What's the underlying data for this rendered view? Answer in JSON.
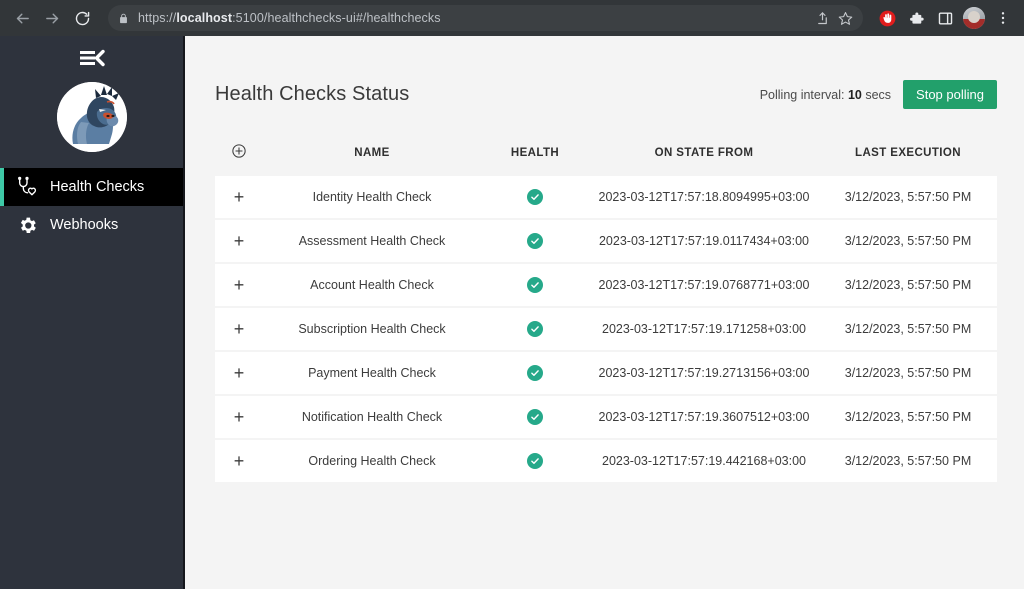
{
  "browser": {
    "url_prefix": "https://",
    "url_host": "localhost",
    "url_rest": ":5100/healthchecks-ui#/healthchecks",
    "back_label": "Back",
    "forward_label": "Forward",
    "reload_label": "Reload",
    "lock_label": "View site information",
    "share_label": "Share this page",
    "bookmark_label": "Bookmark this tab",
    "adblock_label": "AdBlock",
    "extensions_label": "Extensions",
    "sidepanel_label": "Side panel",
    "profile_label": "Profile",
    "menu_label": "Customize and control Google Chrome"
  },
  "sidebar": {
    "toggle_label": "Collapse menu",
    "logo_label": "Application logo",
    "items": [
      {
        "label": "Health Checks",
        "icon": "stethoscope-heart-icon",
        "active": true
      },
      {
        "label": "Webhooks",
        "icon": "gear-icon",
        "active": false
      }
    ]
  },
  "header": {
    "title": "Health Checks Status",
    "polling_prefix": "Polling interval:",
    "polling_value": "10",
    "polling_suffix": "secs",
    "stop_polling_label": "Stop polling"
  },
  "colors": {
    "accent_green": "#22a06b",
    "status_green": "#26a98a",
    "sidebar_bg": "#2e333d",
    "sidebar_active_bg": "#000000",
    "sidebar_active_bar": "#3ec9a7",
    "page_bg": "#f4f4f4",
    "chrome_bg": "#323639"
  },
  "table": {
    "columns": [
      {
        "key": "toggle",
        "label": ""
      },
      {
        "key": "name",
        "label": "NAME"
      },
      {
        "key": "health",
        "label": "HEALTH"
      },
      {
        "key": "state_from",
        "label": "ON STATE FROM"
      },
      {
        "key": "last_execution",
        "label": "LAST EXECUTION"
      }
    ],
    "expand_all_icon": "plus-circle-icon",
    "row_toggle_icon": "plus-icon",
    "health_icon": "check-circle-icon",
    "rows": [
      {
        "name": "Identity Health Check",
        "health": "Healthy",
        "state_from": "2023-03-12T17:57:18.8094995+03:00",
        "last_execution": "3/12/2023, 5:57:50 PM"
      },
      {
        "name": "Assessment Health Check",
        "health": "Healthy",
        "state_from": "2023-03-12T17:57:19.0117434+03:00",
        "last_execution": "3/12/2023, 5:57:50 PM"
      },
      {
        "name": "Account Health Check",
        "health": "Healthy",
        "state_from": "2023-03-12T17:57:19.0768771+03:00",
        "last_execution": "3/12/2023, 5:57:50 PM"
      },
      {
        "name": "Subscription Health Check",
        "health": "Healthy",
        "state_from": "2023-03-12T17:57:19.171258+03:00",
        "last_execution": "3/12/2023, 5:57:50 PM"
      },
      {
        "name": "Payment Health Check",
        "health": "Healthy",
        "state_from": "2023-03-12T17:57:19.2713156+03:00",
        "last_execution": "3/12/2023, 5:57:50 PM"
      },
      {
        "name": "Notification Health Check",
        "health": "Healthy",
        "state_from": "2023-03-12T17:57:19.3607512+03:00",
        "last_execution": "3/12/2023, 5:57:50 PM"
      },
      {
        "name": "Ordering Health Check",
        "health": "Healthy",
        "state_from": "2023-03-12T17:57:19.442168+03:00",
        "last_execution": "3/12/2023, 5:57:50 PM"
      }
    ]
  }
}
